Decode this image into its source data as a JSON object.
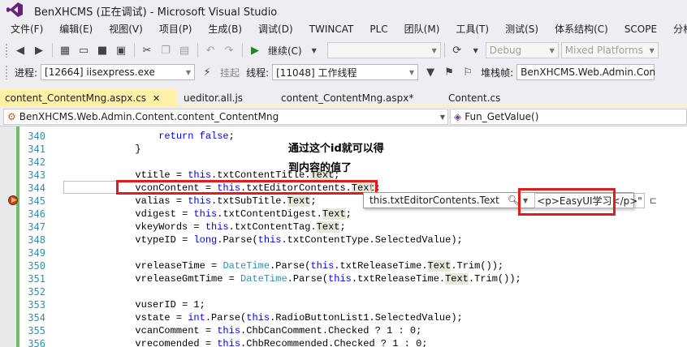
{
  "window": {
    "title": "BenXHCMS (正在调试) - Microsoft Visual Studio"
  },
  "menu": [
    "文件(F)",
    "编辑(E)",
    "视图(V)",
    "项目(P)",
    "生成(B)",
    "调试(D)",
    "TWINCAT",
    "PLC",
    "团队(M)",
    "工具(T)",
    "测试(S)",
    "体系结构(C)",
    "SCOPE",
    "分析"
  ],
  "toolbar": {
    "continue_label": "继续(C)",
    "config": "Debug",
    "platform": "Mixed Platforms"
  },
  "debugbar": {
    "process_label": "进程:",
    "process_value": "[12664] iisexpress.exe",
    "suspend_label": "挂起",
    "thread_label": "线程:",
    "thread_value": "[11048] 工作线程",
    "stackframe_label": "堆栈帧:",
    "stackframe_value": "BenXHCMS.Web.Admin.Con"
  },
  "tabs": [
    {
      "label": "content_ContentMng.aspx.cs",
      "active": true
    },
    {
      "label": "ueditor.all.js",
      "active": false
    },
    {
      "label": "content_ContentMng.aspx*",
      "active": false
    },
    {
      "label": "Content.cs",
      "active": false
    }
  ],
  "nav": {
    "class_value": "BenXHCMS.Web.Admin.Content.content_ContentMng",
    "member_value": "Fun_GetValue()"
  },
  "annotation": {
    "line1": "通过这个id就可以得",
    "line2": "到内容的值了"
  },
  "datatip": {
    "expression": "this.txtEditorContents.Text",
    "value": "<p>EasyUI学习</p>\""
  },
  "lines": [
    {
      "n": "340",
      "html": "                <span class=\"kw\">return false</span>;"
    },
    {
      "n": "341",
      "html": "            }"
    },
    {
      "n": "342",
      "html": ""
    },
    {
      "n": "343",
      "html": "            vtitle = <span class=\"kw\">this</span>.txtContentTitle.<span class=\"hlref\">Text</span>;"
    },
    {
      "n": "344",
      "html": "            vconContent = <span class=\"kw\">this</span>.txtEditorContents.<span class=\"hlref\">Text</span>;"
    },
    {
      "n": "345",
      "html": "            valias = <span class=\"kw\">this</span>.txtSubTitle.<span class=\"hlref\">Text</span>;"
    },
    {
      "n": "346",
      "html": "            vdigest = <span class=\"kw\">this</span>.txtContentDigest.<span class=\"hlref\">Text</span>;"
    },
    {
      "n": "347",
      "html": "            vkeyWords = <span class=\"kw\">this</span>.txtContentTag.<span class=\"hlref\">Text</span>;"
    },
    {
      "n": "348",
      "html": "            vtypeID = <span class=\"kw\">long</span>.Parse(<span class=\"kw\">this</span>.txtContentType.SelectedValue);"
    },
    {
      "n": "349",
      "html": ""
    },
    {
      "n": "350",
      "html": "            vreleaseTime = <span class=\"type\">DateTime</span>.Parse(<span class=\"kw\">this</span>.txtReleaseTime.<span class=\"hlref\">Text</span>.Trim());"
    },
    {
      "n": "351",
      "html": "            vreleaseGmtTime = <span class=\"type\">DateTime</span>.Parse(<span class=\"kw\">this</span>.txtReleaseTime.<span class=\"hlref\">Text</span>.Trim());"
    },
    {
      "n": "352",
      "html": ""
    },
    {
      "n": "353",
      "html": "            vuserID = 1;"
    },
    {
      "n": "354",
      "html": "            vstate = <span class=\"kw\">int</span>.Parse(<span class=\"kw\">this</span>.RadioButtonList1.SelectedValue);"
    },
    {
      "n": "355",
      "html": "            vcanComment = <span class=\"kw\">this</span>.ChbCanComment.Checked ? 1 : 0;"
    },
    {
      "n": "356",
      "html": "            vrecomended = <span class=\"kw\">this</span>.ChbRecommended.Checked ? 1 : 0;"
    }
  ]
}
